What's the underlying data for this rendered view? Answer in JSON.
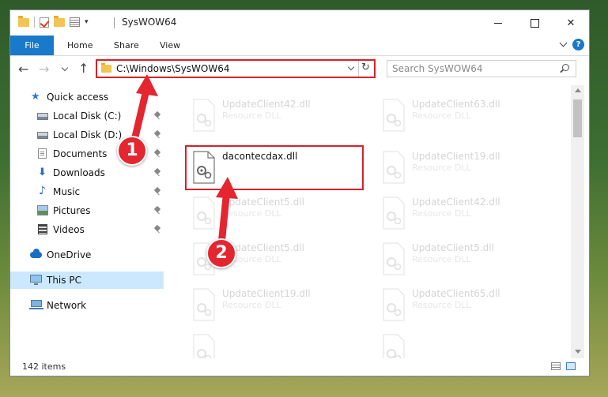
{
  "window": {
    "title": "SysWOW64",
    "controls": {
      "minimize": "",
      "maximize": "",
      "close": "✕"
    }
  },
  "ribbon": {
    "tabs": [
      "File",
      "Home",
      "Share",
      "View"
    ],
    "help_label": "?"
  },
  "address_bar": {
    "path": "C:\\Windows\\SysWOW64",
    "search_placeholder": "Search SysWOW64"
  },
  "sidebar": {
    "items": [
      {
        "label": "Quick access",
        "icon": "star-icon",
        "pinned": false
      },
      {
        "label": "Local Disk (C:)",
        "icon": "disk-icon",
        "pinned": true
      },
      {
        "label": "Local Disk (D:)",
        "icon": "disk-icon",
        "pinned": true
      },
      {
        "label": "Documents",
        "icon": "documents-icon",
        "pinned": true
      },
      {
        "label": "Downloads",
        "icon": "downloads-icon",
        "pinned": true
      },
      {
        "label": "Music",
        "icon": "music-icon",
        "pinned": true
      },
      {
        "label": "Pictures",
        "icon": "pictures-icon",
        "pinned": true
      },
      {
        "label": "Videos",
        "icon": "videos-icon",
        "pinned": true
      },
      {
        "label": "OneDrive",
        "icon": "onedrive-icon",
        "pinned": false
      },
      {
        "label": "This PC",
        "icon": "this-pc-icon",
        "pinned": false,
        "selected": true
      },
      {
        "label": "Network",
        "icon": "network-icon",
        "pinned": false
      }
    ]
  },
  "files": {
    "left": [
      {
        "name": "UpdateClient42.dll",
        "type": "Resource DLL",
        "faded": true
      },
      {
        "name": "dacontecdax.dll",
        "type": "",
        "faded": false,
        "highlighted": true
      },
      {
        "name": "UpdateClient5.dll",
        "type": "Resource DLL",
        "faded": true
      },
      {
        "name": "UpdateClient5.dll",
        "type": "Resource DLL",
        "faded": true
      },
      {
        "name": "UpdateClient19.dll",
        "type": "Resource DLL",
        "faded": true
      },
      {
        "name": "",
        "type": "",
        "faded": true
      }
    ],
    "right": [
      {
        "name": "UpdateClient63.dll",
        "type": "Resource DLL",
        "faded": true
      },
      {
        "name": "UpdateClient19.dll",
        "type": "Resource DLL",
        "faded": true
      },
      {
        "name": "UpdateClient42.dll",
        "type": "Resource DLL",
        "faded": true
      },
      {
        "name": "UpdateClient5.dll",
        "type": "Resource DLL",
        "faded": true
      },
      {
        "name": "UpdateClient65.dll",
        "type": "Resource DLL",
        "faded": true
      },
      {
        "name": "",
        "type": "",
        "faded": true
      }
    ]
  },
  "status_bar": {
    "item_count": "142 items"
  },
  "annotations": {
    "step1": "1",
    "step2": "2",
    "color": "#e3262f"
  }
}
